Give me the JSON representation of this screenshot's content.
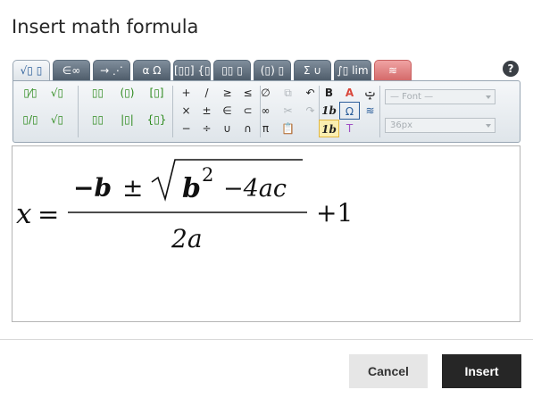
{
  "dialog": {
    "title": "Insert math formula",
    "help_icon": "?"
  },
  "tabs": [
    {
      "label": "√▯ ▯",
      "name": "tab-general"
    },
    {
      "label": "∈∞",
      "name": "tab-symbols"
    },
    {
      "label": "→ ⋰",
      "name": "tab-arrows"
    },
    {
      "label": "α Ω",
      "name": "tab-greek"
    },
    {
      "label": "[▯▯] {▯",
      "name": "tab-matrices"
    },
    {
      "label": "▯▯ ▯",
      "name": "tab-scripts"
    },
    {
      "label": "(▯) ▯",
      "name": "tab-brackets"
    },
    {
      "label": "Σ ∪",
      "name": "tab-big-operators"
    },
    {
      "label": "∫▯ lim",
      "name": "tab-calculus"
    },
    {
      "label": "≋",
      "name": "tab-contextual"
    }
  ],
  "toolbar": {
    "templates": [
      "▯⁄▯",
      "√▯",
      "▯/▯",
      "√▯"
    ],
    "scripts": [
      "▯▯",
      "(▯)",
      "[▯]",
      "▯▯",
      "|▯|",
      "{▯}"
    ],
    "operators": [
      "+",
      "/",
      "≥",
      "≤",
      "×",
      "±",
      "∈",
      "⊂",
      "−",
      "÷",
      "∪",
      "∩"
    ],
    "misc": [
      "∅",
      "⧉",
      "↶",
      "∞",
      "✂",
      "↷",
      "π",
      "📋"
    ],
    "format": [
      "B",
      "A",
      "ݓ",
      "1b",
      "Ω",
      "≋",
      "1b",
      "T",
      ""
    ],
    "font_placeholder": "— Font —",
    "size_placeholder": "36px"
  },
  "formula": {
    "lhs": "x",
    "eq": "=",
    "minus_b": "−b",
    "pm": "±",
    "b_base": "b",
    "b_exp": "2",
    "rest": "−4ac",
    "denominator": "2a",
    "plus_one": "+1"
  },
  "buttons": {
    "cancel": "Cancel",
    "insert": "Insert"
  }
}
